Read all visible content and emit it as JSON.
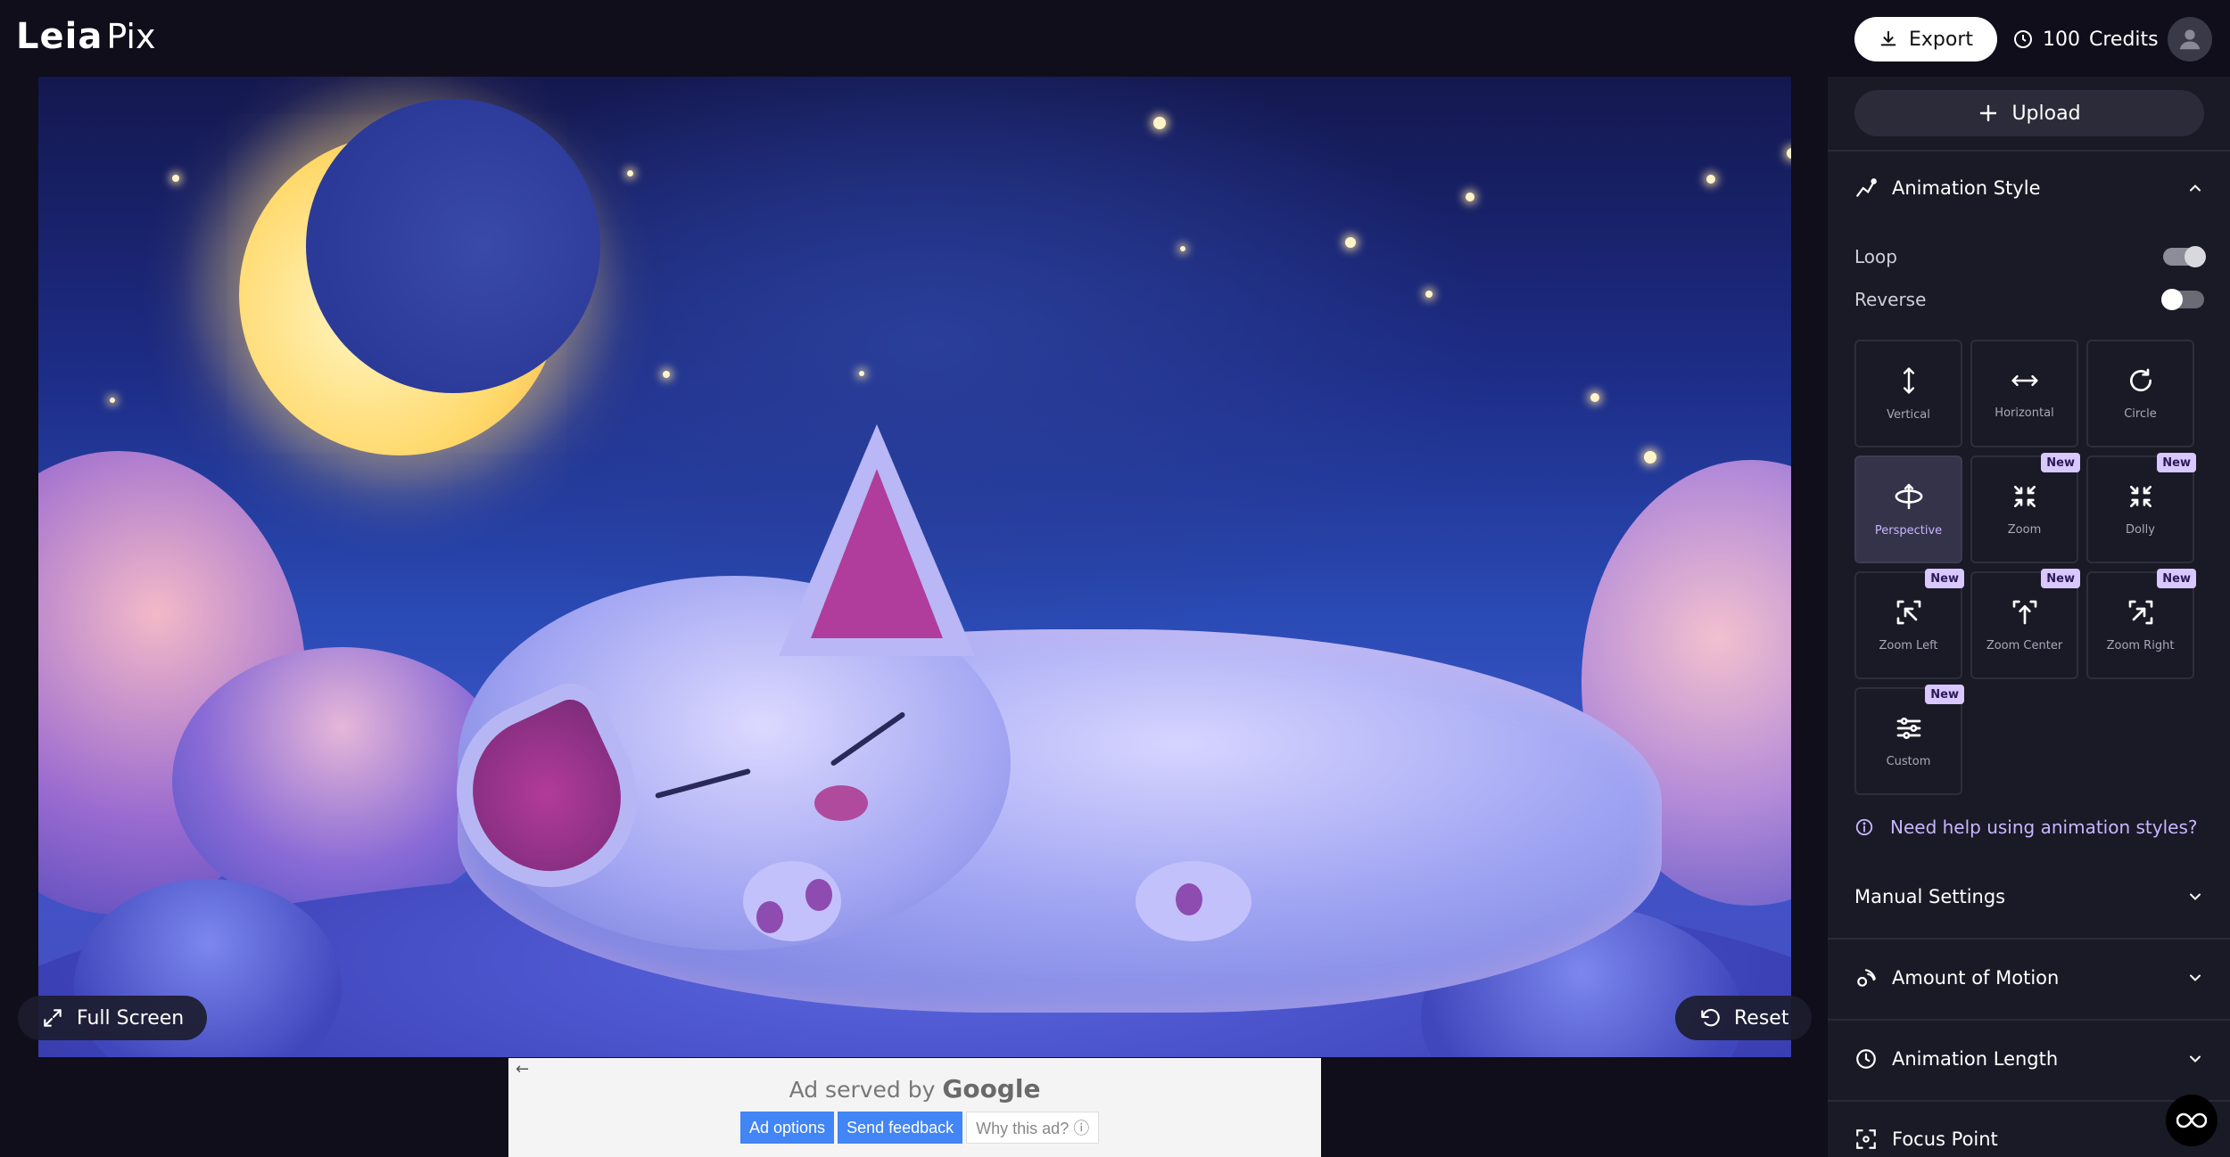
{
  "app": {
    "logo_primary": "Leia",
    "logo_secondary": "Pix"
  },
  "header": {
    "export_label": "Export",
    "credits_count": "100",
    "credits_label": "Credits"
  },
  "canvas": {
    "fullscreen_label": "Full Screen",
    "reset_label": "Reset"
  },
  "ad": {
    "served_by": "Ad served by",
    "brand": "Google",
    "options_label": "Ad options",
    "feedback_label": "Send feedback",
    "why_label": "Why this ad? ⓘ"
  },
  "panel": {
    "upload_label": "Upload",
    "animation_style_title": "Animation Style",
    "loop_label": "Loop",
    "loop_on": true,
    "reverse_label": "Reverse",
    "reverse_on": false,
    "styles": [
      {
        "label": "Vertical",
        "icon": "vertical-arrows-icon",
        "new": false,
        "active": false
      },
      {
        "label": "Horizontal",
        "icon": "horizontal-arrows-icon",
        "new": false,
        "active": false
      },
      {
        "label": "Circle",
        "icon": "circle-arrow-icon",
        "new": false,
        "active": false
      },
      {
        "label": "Perspective",
        "icon": "perspective-icon",
        "new": false,
        "active": true
      },
      {
        "label": "Zoom",
        "icon": "zoom-icon",
        "new": true,
        "active": false
      },
      {
        "label": "Dolly",
        "icon": "dolly-icon",
        "new": true,
        "active": false
      },
      {
        "label": "Zoom Left",
        "icon": "zoom-left-icon",
        "new": true,
        "active": false
      },
      {
        "label": "Zoom Center",
        "icon": "zoom-center-icon",
        "new": true,
        "active": false
      },
      {
        "label": "Zoom Right",
        "icon": "zoom-right-icon",
        "new": true,
        "active": false
      },
      {
        "label": "Custom",
        "icon": "sliders-icon",
        "new": true,
        "active": false
      }
    ],
    "new_badge": "New",
    "help_link": "Need help using animation styles?",
    "manual_settings": "Manual Settings",
    "amount_of_motion": "Amount of Motion",
    "animation_length": "Animation Length",
    "focus_point": "Focus Point"
  },
  "colors": {
    "background": "#0f0e1a",
    "panel": "#1a1926",
    "accent": "#c8b6ff",
    "badge": "#d9c7ff"
  }
}
